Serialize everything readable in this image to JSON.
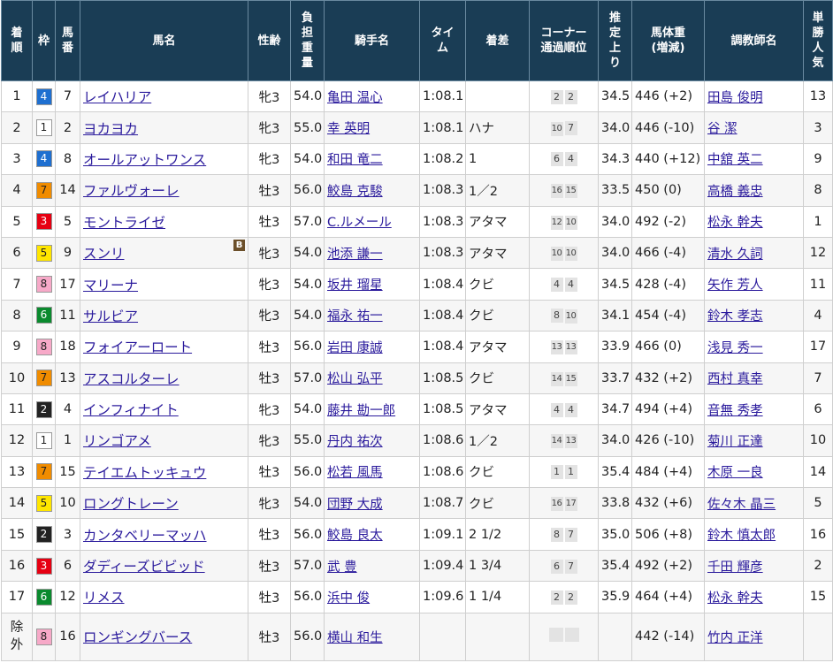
{
  "headers": {
    "rank": [
      "着",
      "順"
    ],
    "waku": "枠",
    "num": [
      "馬",
      "番"
    ],
    "horse": "馬名",
    "sexage": "性齢",
    "weight": [
      "負",
      "担",
      "重",
      "量"
    ],
    "jockey": "騎手名",
    "time": [
      "タイ",
      "ム"
    ],
    "margin": "着差",
    "corner": [
      "コーナー",
      "通過順位"
    ],
    "last3f": [
      "推",
      "定",
      "上",
      "り"
    ],
    "bodyweight": [
      "馬体重",
      "(増減)"
    ],
    "trainer": "調教師名",
    "popularity": [
      "単",
      "勝",
      "人",
      "気"
    ]
  },
  "waku_colors": {
    "1": {
      "bg": "#ffffff",
      "fg": "#222222"
    },
    "2": {
      "bg": "#222222",
      "fg": "#ffffff"
    },
    "3": {
      "bg": "#e60012",
      "fg": "#ffffff"
    },
    "4": {
      "bg": "#1e6fd0",
      "fg": "#ffffff"
    },
    "5": {
      "bg": "#ffe600",
      "fg": "#222222"
    },
    "6": {
      "bg": "#0a8a2e",
      "fg": "#ffffff"
    },
    "7": {
      "bg": "#f08c00",
      "fg": "#222222"
    },
    "8": {
      "bg": "#f7a9c8",
      "fg": "#222222"
    }
  },
  "rows": [
    {
      "rank": "1",
      "waku": "4",
      "num": "7",
      "horse": "レイハリア",
      "sexage": "牝3",
      "weight": "54.0",
      "jockey": "亀田 温心",
      "time": "1:08.1",
      "margin": "",
      "corner": [
        "2",
        "2"
      ],
      "last3f": "34.5",
      "bodyweight": "446 (+2)",
      "trainer": "田島 俊明",
      "popularity": "13"
    },
    {
      "rank": "2",
      "waku": "1",
      "num": "2",
      "horse": "ヨカヨカ",
      "sexage": "牝3",
      "weight": "55.0",
      "jockey": "幸 英明",
      "time": "1:08.1",
      "margin": "ハナ",
      "corner": [
        "10",
        "7"
      ],
      "last3f": "34.0",
      "bodyweight": "446 (-10)",
      "trainer": "谷 潔",
      "popularity": "3"
    },
    {
      "rank": "3",
      "waku": "4",
      "num": "8",
      "horse": "オールアットワンス",
      "sexage": "牝3",
      "weight": "54.0",
      "jockey": "和田 竜二",
      "time": "1:08.2",
      "margin": "1",
      "corner": [
        "6",
        "4"
      ],
      "last3f": "34.3",
      "bodyweight": "440 (+12)",
      "trainer": "中舘 英二",
      "popularity": "9"
    },
    {
      "rank": "4",
      "waku": "7",
      "num": "14",
      "horse": "ファルヴォーレ",
      "sexage": "牡3",
      "weight": "56.0",
      "jockey": "鮫島 克駿",
      "time": "1:08.3",
      "margin": "1／2",
      "corner": [
        "16",
        "15"
      ],
      "last3f": "33.5",
      "bodyweight": "450 (0)",
      "trainer": "高橋 義忠",
      "popularity": "8"
    },
    {
      "rank": "5",
      "waku": "3",
      "num": "5",
      "horse": "モントライゼ",
      "sexage": "牡3",
      "weight": "57.0",
      "jockey": "C.ルメール",
      "time": "1:08.3",
      "margin": "アタマ",
      "corner": [
        "12",
        "10"
      ],
      "last3f": "34.0",
      "bodyweight": "492 (-2)",
      "trainer": "松永 幹夫",
      "popularity": "1"
    },
    {
      "rank": "6",
      "waku": "5",
      "num": "9",
      "horse": "スンリ",
      "blinker": "B",
      "sexage": "牝3",
      "weight": "54.0",
      "jockey": "池添 謙一",
      "time": "1:08.3",
      "margin": "アタマ",
      "corner": [
        "10",
        "10"
      ],
      "last3f": "34.0",
      "bodyweight": "466 (-4)",
      "trainer": "清水 久詞",
      "popularity": "12"
    },
    {
      "rank": "7",
      "waku": "8",
      "num": "17",
      "horse": "マリーナ",
      "sexage": "牝3",
      "weight": "54.0",
      "jockey": "坂井 瑠星",
      "time": "1:08.4",
      "margin": "クビ",
      "corner": [
        "4",
        "4"
      ],
      "last3f": "34.5",
      "bodyweight": "428 (-4)",
      "trainer": "矢作 芳人",
      "popularity": "11"
    },
    {
      "rank": "8",
      "waku": "6",
      "num": "11",
      "horse": "サルビア",
      "sexage": "牝3",
      "weight": "54.0",
      "jockey": "福永 祐一",
      "time": "1:08.4",
      "margin": "クビ",
      "corner": [
        "8",
        "10"
      ],
      "last3f": "34.1",
      "bodyweight": "454 (-4)",
      "trainer": "鈴木 孝志",
      "popularity": "4"
    },
    {
      "rank": "9",
      "waku": "8",
      "num": "18",
      "horse": "フォイアーロート",
      "sexage": "牡3",
      "weight": "56.0",
      "jockey": "岩田 康誠",
      "time": "1:08.4",
      "margin": "アタマ",
      "corner": [
        "13",
        "13"
      ],
      "last3f": "33.9",
      "bodyweight": "466 (0)",
      "trainer": "浅見 秀一",
      "popularity": "17"
    },
    {
      "rank": "10",
      "waku": "7",
      "num": "13",
      "horse": "アスコルターレ",
      "sexage": "牡3",
      "weight": "57.0",
      "jockey": "松山 弘平",
      "time": "1:08.5",
      "margin": "クビ",
      "corner": [
        "14",
        "15"
      ],
      "last3f": "33.7",
      "bodyweight": "432 (+2)",
      "trainer": "西村 真幸",
      "popularity": "7"
    },
    {
      "rank": "11",
      "waku": "2",
      "num": "4",
      "horse": "インフィナイト",
      "sexage": "牝3",
      "weight": "54.0",
      "jockey": "藤井 勘一郎",
      "time": "1:08.5",
      "margin": "アタマ",
      "corner": [
        "4",
        "4"
      ],
      "last3f": "34.7",
      "bodyweight": "494 (+4)",
      "trainer": "音無 秀孝",
      "popularity": "6"
    },
    {
      "rank": "12",
      "waku": "1",
      "num": "1",
      "horse": "リンゴアメ",
      "sexage": "牝3",
      "weight": "55.0",
      "jockey": "丹内 祐次",
      "time": "1:08.6",
      "margin": "1／2",
      "corner": [
        "14",
        "13"
      ],
      "last3f": "34.0",
      "bodyweight": "426 (-10)",
      "trainer": "菊川 正達",
      "popularity": "10"
    },
    {
      "rank": "13",
      "waku": "7",
      "num": "15",
      "horse": "テイエムトッキュウ",
      "sexage": "牡3",
      "weight": "56.0",
      "jockey": "松若 風馬",
      "time": "1:08.6",
      "margin": "クビ",
      "corner": [
        "1",
        "1"
      ],
      "last3f": "35.4",
      "bodyweight": "484 (+4)",
      "trainer": "木原 一良",
      "popularity": "14"
    },
    {
      "rank": "14",
      "waku": "5",
      "num": "10",
      "horse": "ロングトレーン",
      "sexage": "牝3",
      "weight": "54.0",
      "jockey": "団野 大成",
      "time": "1:08.7",
      "margin": "クビ",
      "corner": [
        "16",
        "17"
      ],
      "last3f": "33.8",
      "bodyweight": "432 (+6)",
      "trainer": "佐々木 晶三",
      "popularity": "5"
    },
    {
      "rank": "15",
      "waku": "2",
      "num": "3",
      "horse": "カンタベリーマッハ",
      "sexage": "牡3",
      "weight": "56.0",
      "jockey": "鮫島 良太",
      "time": "1:09.1",
      "margin": "2 1/2",
      "corner": [
        "8",
        "7"
      ],
      "last3f": "35.0",
      "bodyweight": "506 (+8)",
      "trainer": "鈴木 慎太郎",
      "popularity": "16"
    },
    {
      "rank": "16",
      "waku": "3",
      "num": "6",
      "horse": "ダディーズビビッド",
      "sexage": "牡3",
      "weight": "57.0",
      "jockey": "武 豊",
      "time": "1:09.4",
      "margin": "1 3/4",
      "corner": [
        "6",
        "7"
      ],
      "last3f": "35.4",
      "bodyweight": "492 (+2)",
      "trainer": "千田 輝彦",
      "popularity": "2"
    },
    {
      "rank": "17",
      "waku": "6",
      "num": "12",
      "horse": "リメス",
      "sexage": "牡3",
      "weight": "56.0",
      "jockey": "浜中 俊",
      "time": "1:09.6",
      "margin": "1 1/4",
      "corner": [
        "2",
        "2"
      ],
      "last3f": "35.9",
      "bodyweight": "464 (+4)",
      "trainer": "松永 幹夫",
      "popularity": "15"
    },
    {
      "rank": "除外",
      "waku": "8",
      "num": "16",
      "horse": "ロンギングバース",
      "sexage": "牡3",
      "weight": "56.0",
      "jockey": "横山 和生",
      "time": "",
      "margin": "",
      "corner": [
        "",
        ""
      ],
      "last3f": "",
      "bodyweight": "442 (-14)",
      "trainer": "竹内 正洋",
      "popularity": "",
      "tall": true
    }
  ]
}
